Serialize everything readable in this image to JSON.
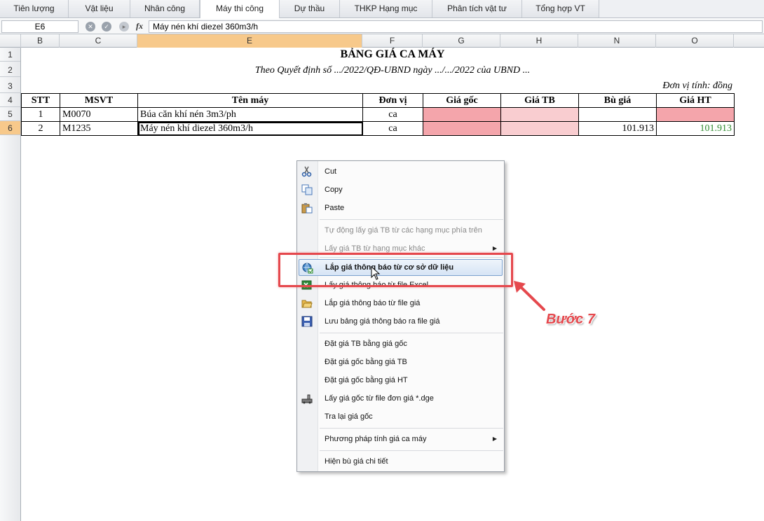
{
  "tabs": [
    {
      "label": "Tiên lượng",
      "active": false
    },
    {
      "label": "Vật liệu",
      "active": false
    },
    {
      "label": "Nhân công",
      "active": false
    },
    {
      "label": "Máy thi công",
      "active": true
    },
    {
      "label": "Dự thầu",
      "active": false
    },
    {
      "label": "THKP Hạng mục",
      "active": false
    },
    {
      "label": "Phân tích vật tư",
      "active": false
    },
    {
      "label": "Tổng hợp VT",
      "active": false
    }
  ],
  "formula_bar": {
    "cell_ref": "E6",
    "fx_label": "fx",
    "value": "Máy nén khí diezel 360m3/h"
  },
  "columns": [
    "B",
    "C",
    "E",
    "F",
    "G",
    "H",
    "N",
    "O"
  ],
  "selected_column": "E",
  "rows": [
    "1",
    "2",
    "3",
    "4",
    "5",
    "6"
  ],
  "selected_row": "6",
  "sheet": {
    "title": "BẢNG GIÁ CA MÁY",
    "subtitle": "Theo Quyết định số .../2022/QĐ-UBND ngày .../.../2022 của UBND ...",
    "unit_note": "Đơn vị tính: đồng",
    "headers": [
      "STT",
      "MSVT",
      "Tên máy",
      "Đơn vị",
      "Giá gốc",
      "Giá TB",
      "Bù giá",
      "Giá HT"
    ],
    "rows": [
      {
        "stt": "1",
        "msvt": "M0070",
        "name": "Búa căn khí nén 3m3/ph",
        "unit": "ca",
        "gia_goc": "",
        "gia_tb": "",
        "bu_gia": "",
        "gia_ht": ""
      },
      {
        "stt": "2",
        "msvt": "M1235",
        "name": "Máy nén khí diezel 360m3/h",
        "unit": "ca",
        "gia_goc": "",
        "gia_tb": "",
        "bu_gia": "101.913",
        "gia_ht": "101.913"
      }
    ]
  },
  "context_menu": {
    "items": [
      {
        "label": "Cut",
        "icon": "scissors-icon",
        "disabled": false
      },
      {
        "label": "Copy",
        "icon": "copy-icon",
        "disabled": false
      },
      {
        "label": "Paste",
        "icon": "paste-icon",
        "disabled": false
      },
      {
        "label": "Tự động lấy giá TB từ các hạng mục phía trên",
        "disabled": true
      },
      {
        "label": "Lấy giá TB từ hạng mục khác",
        "disabled": true,
        "submenu": true
      },
      {
        "label": "Lắp giá thông báo từ cơ sở dữ liệu",
        "icon": "database-icon",
        "highlighted": true
      },
      {
        "label": "Lấy giá thông báo từ file Excel",
        "icon": "excel-icon"
      },
      {
        "label": "Lắp giá thông báo từ file giá",
        "icon": "folder-open-icon"
      },
      {
        "label": "Lưu bảng giá thông báo ra file giá",
        "icon": "save-icon"
      },
      {
        "label": "Đặt giá TB bằng giá gốc"
      },
      {
        "label": "Đặt giá gốc bằng giá TB"
      },
      {
        "label": "Đặt giá gốc bằng giá HT"
      },
      {
        "label": "Lấy giá gốc từ file đơn giá *.dge",
        "icon": "machine-icon"
      },
      {
        "label": "Tra lại giá gốc"
      },
      {
        "label": "Phương pháp tính giá ca máy",
        "submenu": true
      },
      {
        "label": "Hiện bù giá chi tiết"
      }
    ]
  },
  "annotation": {
    "label": "Bước 7",
    "color": "#e5484d"
  },
  "colors": {
    "pink_cell": "#f4a5ab",
    "light_pink_cell": "#f9cdd0",
    "selected_header": "#f7c98b",
    "green_value": "#2e8b2e"
  }
}
